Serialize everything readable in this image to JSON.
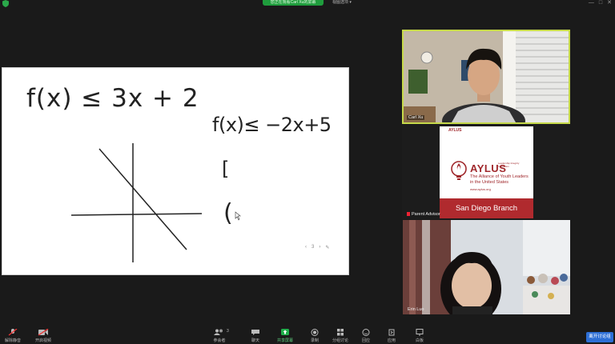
{
  "top_bar": {
    "share_indicator": "您正在观看Carl Xu的屏幕",
    "view_options": "视图选项"
  },
  "whiteboard": {
    "equation_1": "f(x) ≤ 3x + 2",
    "equation_2": "f(x)≤ −2x+5",
    "bracket": "[",
    "paren": "(",
    "page_number": "3"
  },
  "participants": [
    {
      "name": "Carl Xu",
      "accent": "#c6d94a"
    },
    {
      "name": "Parent Advisor",
      "muted": true
    },
    {
      "name": "Erin Luo"
    }
  ],
  "slide": {
    "tab": "AYLUS",
    "title": "AYLUS",
    "subtitle": "Leadership Integrity Innovation",
    "tagline_1": "The Alliance of Youth Leaders",
    "tagline_2": "in the United States",
    "url": "www.aylus.org",
    "banner": "San Diego Branch",
    "brand_color": "#b02a2e"
  },
  "toolbar": {
    "unmute": "解除静音",
    "start_video": "开启视频",
    "participants": "参会者",
    "participants_count": "3",
    "chat": "聊天",
    "share_screen": "共享屏幕",
    "record": "录制",
    "breakout": "分组讨论",
    "reactions": "回应",
    "apps": "应用",
    "whiteboards": "白板",
    "leave": "离开讨论组"
  },
  "colors": {
    "share_green": "#1f9d3d",
    "leave_blue": "#2d6fd6",
    "active_speaker": "#c6d94a"
  }
}
